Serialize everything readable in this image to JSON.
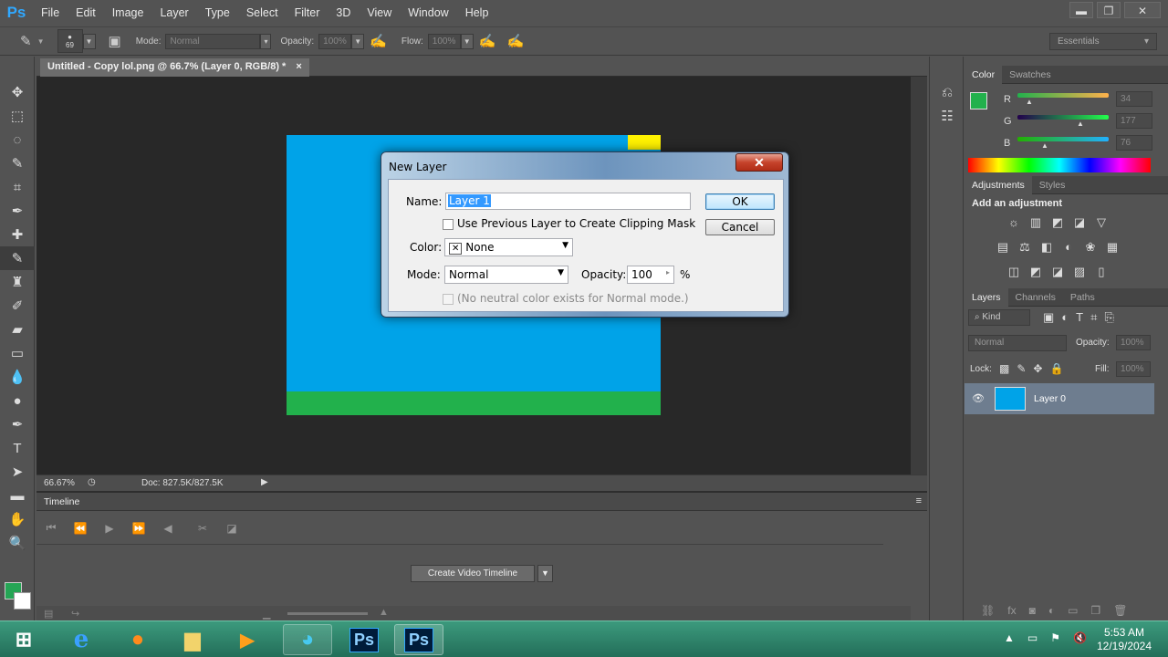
{
  "app": {
    "logo": "Ps"
  },
  "menu": [
    "File",
    "Edit",
    "Image",
    "Layer",
    "Type",
    "Select",
    "Filter",
    "3D",
    "View",
    "Window",
    "Help"
  ],
  "window_controls": {
    "minimize": "▬",
    "restore": "❐",
    "close": "✕"
  },
  "options_bar": {
    "brush_size": "69",
    "mode_label": "Mode:",
    "mode_value": "Normal",
    "opacity_label": "Opacity:",
    "opacity_value": "100%",
    "flow_label": "Flow:",
    "flow_value": "100%",
    "workspace": "Essentials"
  },
  "document": {
    "tab_title": "Untitled - Copy lol.png @ 66.7% (Layer 0, RGB/8) *",
    "tab_close": "×"
  },
  "status": {
    "zoom": "66.67%",
    "doc": "Doc: 827.5K/827.5K"
  },
  "timeline": {
    "title": "Timeline",
    "create_button": "Create Video Timeline"
  },
  "color_panel": {
    "tabs": [
      "Color",
      "Swatches"
    ],
    "r_label": "R",
    "r_value": "34",
    "g_label": "G",
    "g_value": "177",
    "b_label": "B",
    "b_value": "76",
    "r_level": 0.13,
    "g_level": 0.69,
    "b_level": 0.3,
    "fg_color": "#22b14c"
  },
  "adjustments_panel": {
    "tabs": [
      "Adjustments",
      "Styles"
    ],
    "heading": "Add an adjustment"
  },
  "layers_panel": {
    "tabs": [
      "Layers",
      "Channels",
      "Paths"
    ],
    "filter_kind": "Kind",
    "blend_mode": "Normal",
    "opacity_label": "Opacity:",
    "opacity_value": "100%",
    "lock_label": "Lock:",
    "fill_label": "Fill:",
    "fill_value": "100%",
    "layers": [
      {
        "name": "Layer 0"
      }
    ]
  },
  "dialog": {
    "title": "New Layer",
    "close": "✕",
    "name_label": "Name:",
    "name_value": "Layer 1",
    "clipping_label": "Use Previous Layer to Create Clipping Mask",
    "color_label": "Color:",
    "color_value": "None",
    "mode_label": "Mode:",
    "mode_value": "Normal",
    "opacity_label": "Opacity:",
    "opacity_value": "100",
    "opacity_unit": "%",
    "neutral_label": "(No neutral color exists for Normal mode.)",
    "ok": "OK",
    "cancel": "Cancel"
  },
  "taskbar": {
    "time": "5:53 AM",
    "date": "12/19/2024",
    "ps_label": "Ps"
  },
  "canvas_colors": {
    "sky": "#00a3e8",
    "grass": "#22b14c",
    "sun": "#fff200"
  }
}
